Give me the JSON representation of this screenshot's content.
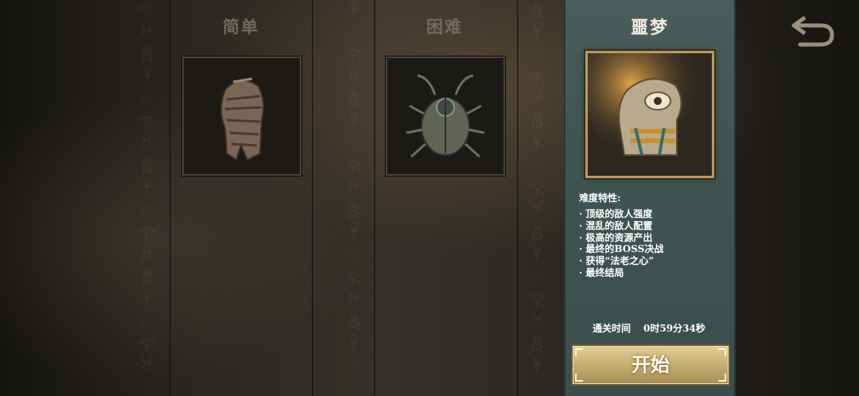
{
  "tiers": {
    "easy": {
      "title": "简单",
      "icon": "mummy-icon"
    },
    "hard": {
      "title": "困难",
      "icon": "scarab-icon"
    },
    "nightmare": {
      "title": "噩梦",
      "icon": "horus-eye-icon"
    }
  },
  "details": {
    "heading": "难度特性:",
    "features": [
      "· 顶级的敌人强度",
      "· 混乱的敌人配置",
      "· 极高的资源产出",
      "· 最终的BOSS决战",
      "· 获得“法老之心”",
      "· 最终结局"
    ],
    "clear_time_label": "通关时间",
    "clear_time_value": "0时59分34秒"
  },
  "start_button": "开始",
  "back_icon": "back-arrow-icon",
  "colors": {
    "panel": "#45595a",
    "gold": "#c7ae72",
    "inactive_title": "#6f6a62"
  }
}
